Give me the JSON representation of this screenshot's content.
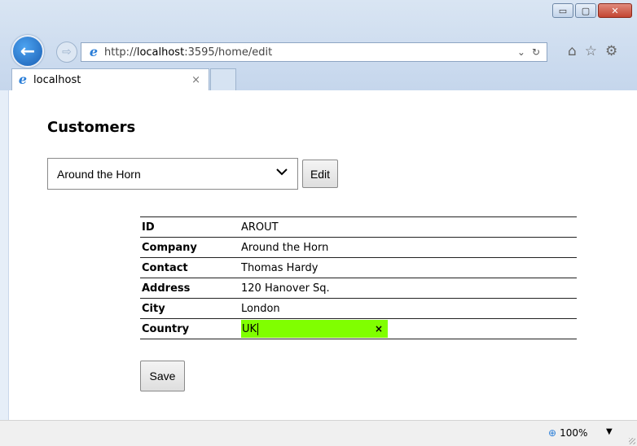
{
  "browser": {
    "url_prefix": "http://",
    "url_host": "localhost",
    "url_rest": ":3595/home/edit",
    "tab_title": "localhost",
    "tab_close": "×",
    "window_buttons": {
      "minimize": "▭",
      "maximize": "▢",
      "close": "✕"
    },
    "nav": {
      "back": "←",
      "forward": "⇨"
    },
    "addr_tools": {
      "compat": "⌄",
      "refresh": "↻"
    },
    "toolbar_icons": {
      "home": "⌂",
      "favorites": "☆",
      "settings": "⚙"
    },
    "ie_glyph": "e"
  },
  "page": {
    "title": "Customers",
    "customer_select": {
      "value": "Around the Horn"
    },
    "edit_label": "Edit",
    "save_label": "Save",
    "fields": [
      {
        "label": "ID",
        "value": "AROUT"
      },
      {
        "label": "Company",
        "value": "Around the Horn"
      },
      {
        "label": "Contact",
        "value": "Thomas Hardy"
      },
      {
        "label": "Address",
        "value": "120 Hanover Sq."
      },
      {
        "label": "City",
        "value": "London"
      },
      {
        "label": "Country",
        "value": "UK"
      }
    ],
    "clear_glyph": "×"
  },
  "status": {
    "zoom": "100%",
    "zoom_icon": "zoom-in-icon",
    "zoom_glyph": "⊕",
    "dropdown_glyph": "▼"
  },
  "colors": {
    "highlight": "#80ff00",
    "chrome": "#c5d6ec"
  }
}
